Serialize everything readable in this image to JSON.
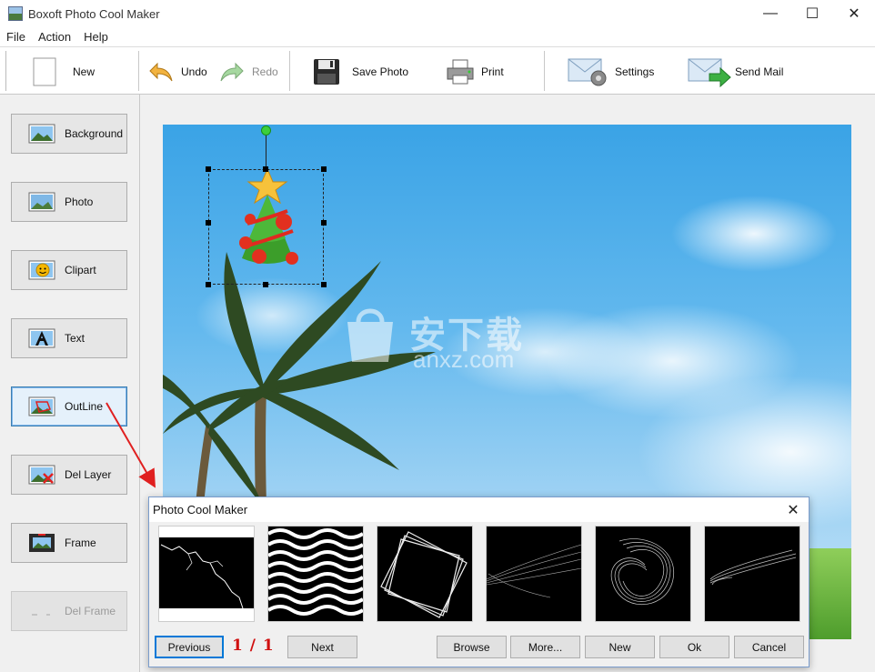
{
  "window": {
    "title": "Boxoft Photo Cool Maker",
    "controls": {
      "minimize": "—",
      "maximize": "☐",
      "close": "✕"
    }
  },
  "menu": [
    "File",
    "Action",
    "Help"
  ],
  "toolbar": {
    "new": "New",
    "undo": "Undo",
    "redo": "Redo",
    "save_photo": "Save Photo",
    "print": "Print",
    "settings": "Settings",
    "send_mail": "Send Mail"
  },
  "sidebar": {
    "items": [
      {
        "label": "Background",
        "icon": "landscape-icon"
      },
      {
        "label": "Photo",
        "icon": "photo-icon"
      },
      {
        "label": "Clipart",
        "icon": "smiley-icon"
      },
      {
        "label": "Text",
        "icon": "text-a-icon"
      },
      {
        "label": "OutLine",
        "icon": "outline-icon",
        "state": "active"
      },
      {
        "label": "Del Layer",
        "icon": "delete-layer-icon"
      },
      {
        "label": "Frame",
        "icon": "frame-icon"
      },
      {
        "label": "Del Frame",
        "icon": "delete-frame-icon",
        "state": "disabled"
      }
    ]
  },
  "canvas": {
    "watermark_cn": "安下载",
    "watermark_en": "anxz.com",
    "clipart": "christmas-tree-icon"
  },
  "dialog": {
    "title": "Photo Cool Maker",
    "close": "✕",
    "thumbnails": [
      "lightning-outline",
      "wave-lines-outline",
      "square-frame-outline",
      "mesh-ribbon-outline",
      "swirl-rings-outline",
      "sweep-curve-outline"
    ],
    "page_indicator": "1 / 1",
    "buttons": {
      "previous": "Previous",
      "next": "Next",
      "browse": "Browse",
      "more": "More...",
      "new": "New",
      "ok": "Ok",
      "cancel": "Cancel"
    }
  },
  "colors": {
    "accent_blue": "#3c7fb1",
    "arrow_red": "#e02020",
    "page_indicator_red": "#d01010",
    "sky": "#3aa3e6"
  }
}
